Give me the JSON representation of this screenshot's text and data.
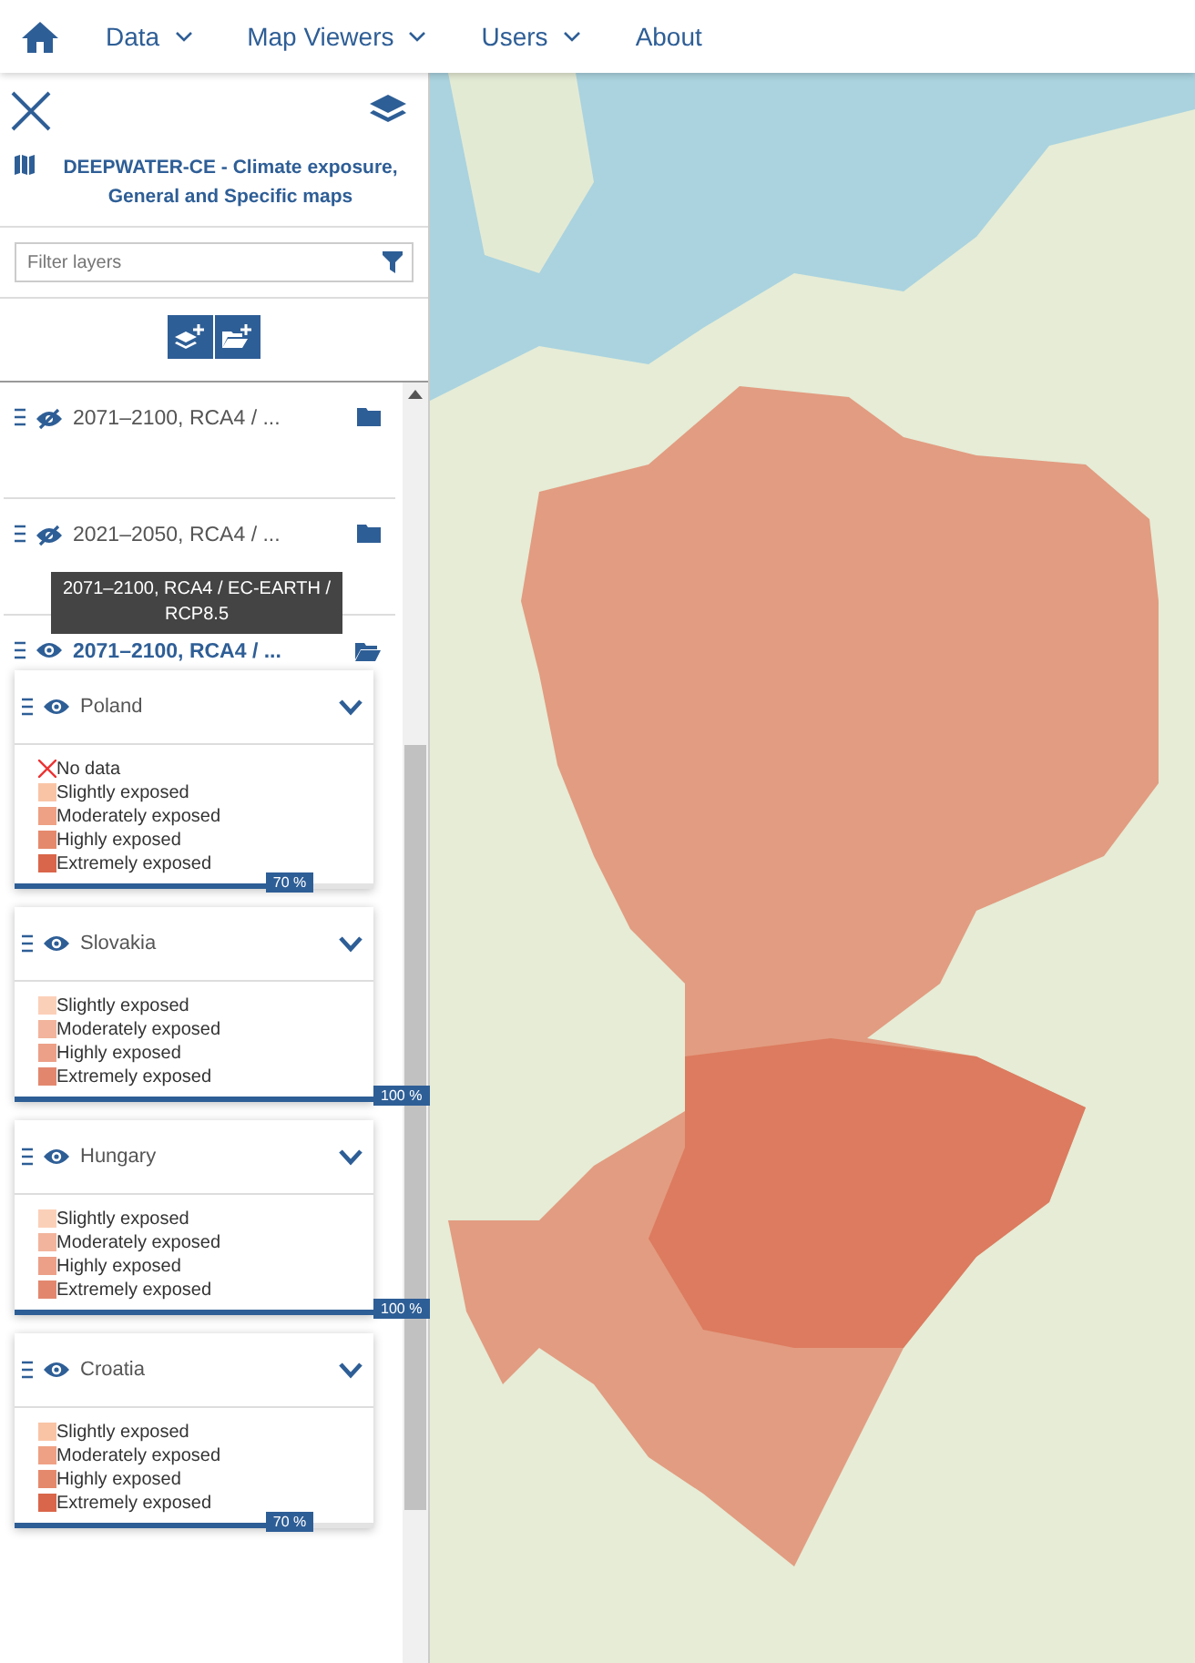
{
  "nav": {
    "items": [
      {
        "label": "Data",
        "dropdown": true
      },
      {
        "label": "Map Viewers",
        "dropdown": true
      },
      {
        "label": "Users",
        "dropdown": true
      },
      {
        "label": "About",
        "dropdown": false
      }
    ]
  },
  "sidebar": {
    "title": "DEEPWATER-CE - Climate exposure, General and Specific maps",
    "filter": {
      "placeholder": "Filter layers"
    },
    "groups": [
      {
        "label": "2071–2100, RCA4 / ...",
        "visible": false,
        "expanded": false
      },
      {
        "label": "2021–2050, RCA4 / ...",
        "visible": false,
        "expanded": false
      },
      {
        "label": "2071–2100, RCA4 / ...",
        "visible": true,
        "expanded": true,
        "tooltip": "2071–2100, RCA4 / EC-EARTH / RCP8.5"
      }
    ],
    "layers": [
      {
        "name": "Poland",
        "visible": true,
        "level": 0.7,
        "reading": "70 %",
        "legend": [
          {
            "kind": "nodata",
            "label": "No data"
          },
          {
            "kind": "swatch",
            "label": "Slightly exposed",
            "color": "#f9c4a6"
          },
          {
            "kind": "swatch",
            "label": "Moderately exposed",
            "color": "#eea184"
          },
          {
            "kind": "swatch",
            "label": "Highly exposed",
            "color": "#e5896c"
          },
          {
            "kind": "swatch",
            "label": "Extremely exposed",
            "color": "#d9664a"
          }
        ]
      },
      {
        "name": "Slovakia",
        "visible": true,
        "level": 1.0,
        "reading": "100 %",
        "legend": [
          {
            "kind": "swatch",
            "label": "Slightly exposed",
            "color": "#fbd0b8"
          },
          {
            "kind": "swatch",
            "label": "Moderately exposed",
            "color": "#f2b49c"
          },
          {
            "kind": "swatch",
            "label": "Highly exposed",
            "color": "#eca088"
          },
          {
            "kind": "swatch",
            "label": "Extremely exposed",
            "color": "#e2876e"
          }
        ]
      },
      {
        "name": "Hungary",
        "visible": true,
        "level": 1.0,
        "reading": "100 %",
        "legend": [
          {
            "kind": "swatch",
            "label": "Slightly exposed",
            "color": "#fbd0b8"
          },
          {
            "kind": "swatch",
            "label": "Moderately exposed",
            "color": "#f2b49c"
          },
          {
            "kind": "swatch",
            "label": "Highly exposed",
            "color": "#eca088"
          },
          {
            "kind": "swatch",
            "label": "Extremely exposed",
            "color": "#e2876e"
          }
        ]
      },
      {
        "name": "Croatia",
        "visible": true,
        "level": 0.7,
        "reading": "70 %",
        "legend": [
          {
            "kind": "swatch",
            "label": "Slightly exposed",
            "color": "#f9c4a6"
          },
          {
            "kind": "swatch",
            "label": "Moderately exposed",
            "color": "#eea184"
          },
          {
            "kind": "swatch",
            "label": "Highly exposed",
            "color": "#e5896c"
          },
          {
            "kind": "swatch",
            "label": "Extremely exposed",
            "color": "#d9664a"
          }
        ]
      }
    ]
  }
}
